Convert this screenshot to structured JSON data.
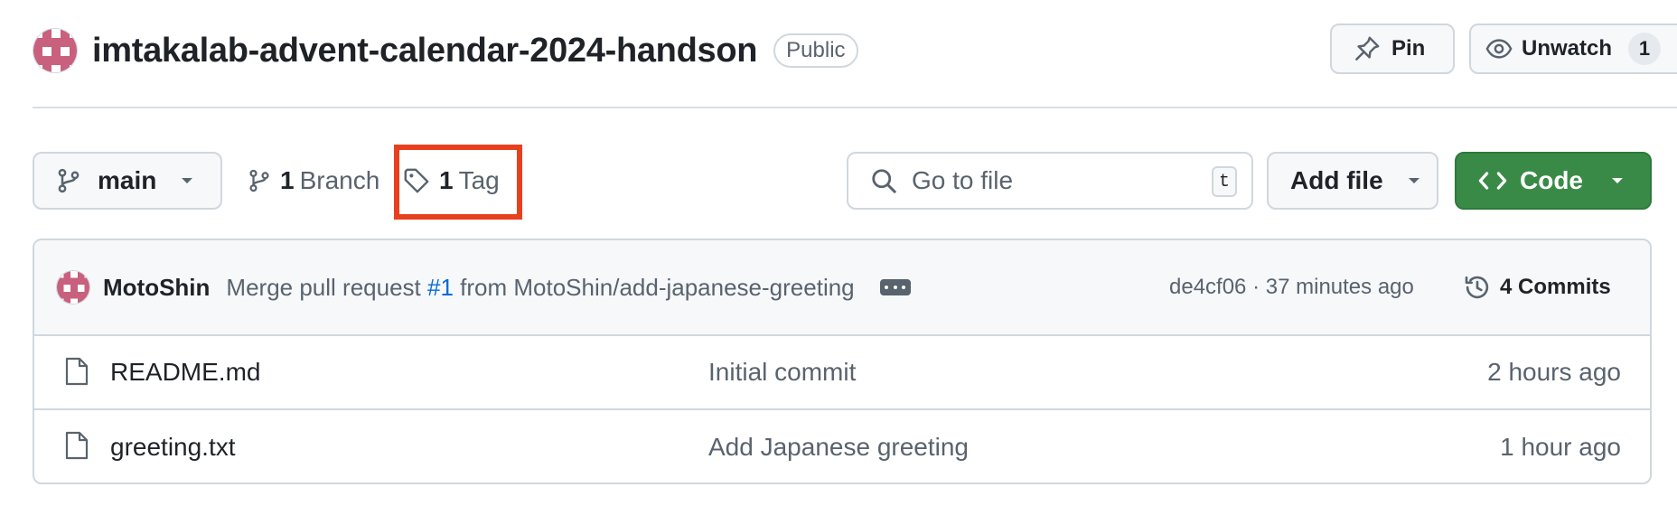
{
  "header": {
    "repo_name": "imtakalab-advent-calendar-2024-handson",
    "visibility": "Public",
    "pin_label": "Pin",
    "watch_label": "Unwatch",
    "watch_count": "1"
  },
  "toolbar": {
    "branch": "main",
    "branch_count": "1",
    "branch_label": "Branch",
    "tag_count": "1",
    "tag_label": "Tag",
    "search_placeholder": "Go to file",
    "search_shortcut": "t",
    "add_file_label": "Add file",
    "code_label": "Code"
  },
  "latest_commit": {
    "author": "MotoShin",
    "message_prefix": "Merge pull request",
    "pr_link": "#1",
    "message_suffix": "from MotoShin/add-japanese-greeting",
    "sha": "de4cf06",
    "separator": "·",
    "time": "37 minutes ago",
    "commit_count": "4",
    "commits_label": "Commits"
  },
  "files": [
    {
      "name": "README.md",
      "commit_message": "Initial commit",
      "age": "2 hours ago"
    },
    {
      "name": "greeting.txt",
      "commit_message": "Add Japanese greeting",
      "age": "1 hour ago"
    }
  ],
  "colors": {
    "highlight": "#e8401f",
    "code_button": "#3a8a47",
    "link": "#0969da",
    "avatar_pink": "#c8607e"
  },
  "icons": {
    "branch": "git-branch-icon",
    "tag": "tag-icon",
    "search": "search-icon",
    "pin": "pin-icon",
    "watch": "eye-icon",
    "history": "history-icon",
    "file": "file-icon",
    "code": "code-icon"
  }
}
